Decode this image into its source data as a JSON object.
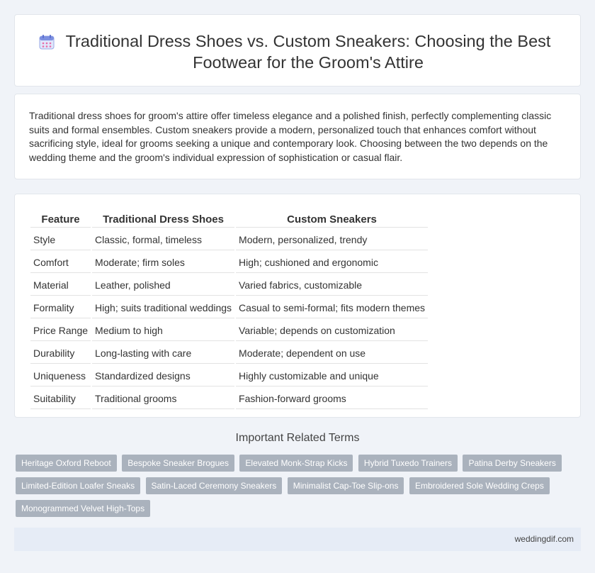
{
  "header": {
    "title": "Traditional Dress Shoes vs. Custom Sneakers: Choosing the Best Footwear for the Groom's Attire",
    "icon": "calendar-icon"
  },
  "intro": {
    "text": "Traditional dress shoes for groom's attire offer timeless elegance and a polished finish, perfectly complementing classic suits and formal ensembles. Custom sneakers provide a modern, personalized touch that enhances comfort without sacrificing style, ideal for grooms seeking a unique and contemporary look. Choosing between the two depends on the wedding theme and the groom's individual expression of sophistication or casual flair."
  },
  "table": {
    "headers": [
      "Feature",
      "Traditional Dress Shoes",
      "Custom Sneakers"
    ],
    "rows": [
      [
        "Style",
        "Classic, formal, timeless",
        "Modern, personalized, trendy"
      ],
      [
        "Comfort",
        "Moderate; firm soles",
        "High; cushioned and ergonomic"
      ],
      [
        "Material",
        "Leather, polished",
        "Varied fabrics, customizable"
      ],
      [
        "Formality",
        "High; suits traditional weddings",
        "Casual to semi-formal; fits modern themes"
      ],
      [
        "Price Range",
        "Medium to high",
        "Variable; depends on customization"
      ],
      [
        "Durability",
        "Long-lasting with care",
        "Moderate; dependent on use"
      ],
      [
        "Uniqueness",
        "Standardized designs",
        "Highly customizable and unique"
      ],
      [
        "Suitability",
        "Traditional grooms",
        "Fashion-forward grooms"
      ]
    ]
  },
  "related": {
    "heading": "Important Related Terms",
    "tags": [
      "Heritage Oxford Reboot",
      "Bespoke Sneaker Brogues",
      "Elevated Monk-Strap Kicks",
      "Hybrid Tuxedo Trainers",
      "Patina Derby Sneakers",
      "Limited-Edition Loafer Sneaks",
      "Satin-Laced Ceremony Sneakers",
      "Minimalist Cap-Toe Slip-ons",
      "Embroidered Sole Wedding Creps",
      "Monogrammed Velvet High-Tops"
    ]
  },
  "footer": {
    "site": "weddingdif.com"
  },
  "colors": {
    "background": "#f0f3f8",
    "tag_background": "#aab2bd",
    "footer_background": "#e6ecf6",
    "icon_accent": "#e86aa8"
  }
}
